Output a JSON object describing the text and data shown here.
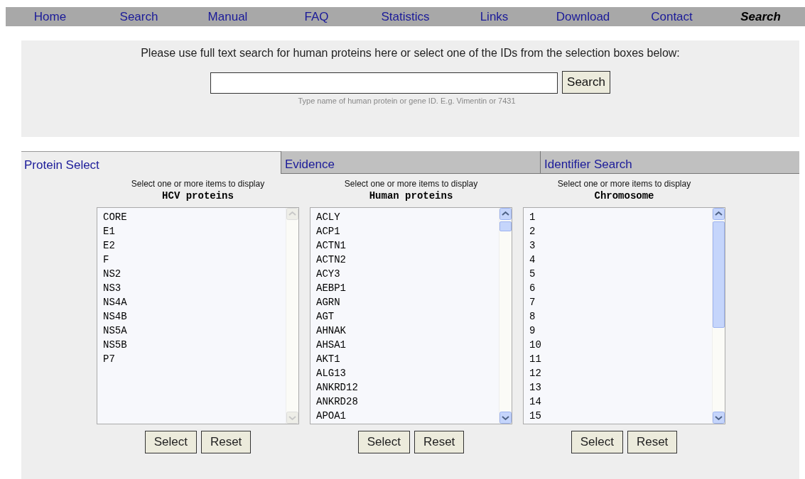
{
  "nav": [
    {
      "label": "Home",
      "selected": false
    },
    {
      "label": "Search",
      "selected": false
    },
    {
      "label": "Manual",
      "selected": false
    },
    {
      "label": "FAQ",
      "selected": false
    },
    {
      "label": "Statistics",
      "selected": false
    },
    {
      "label": "Links",
      "selected": false
    },
    {
      "label": "Download",
      "selected": false
    },
    {
      "label": "Contact",
      "selected": false
    },
    {
      "label": "Search",
      "selected": true
    }
  ],
  "search": {
    "intro": "Please use full text search for human proteins here or select one of the IDs from the selection boxes below:",
    "button": "Search",
    "hint": "Type name of human protein or gene ID. E.g. Vimentin or 7431"
  },
  "tabs": [
    {
      "label": "Protein Select",
      "selected": true
    },
    {
      "label": "Evidence",
      "selected": false
    },
    {
      "label": "Identifier Search",
      "selected": false
    }
  ],
  "lists": [
    {
      "caption": "Select one or more items to display",
      "title": "HCV proteins",
      "items": [
        "CORE",
        "E1",
        "E2",
        "F",
        "NS2",
        "NS3",
        "NS4A",
        "NS4B",
        "NS5A",
        "NS5B",
        "P7"
      ],
      "buttons": [
        "Select",
        "Reset"
      ]
    },
    {
      "caption": "Select one or more items to display",
      "title": "Human proteins",
      "items": [
        "ACLY",
        "ACP1",
        "ACTN1",
        "ACTN2",
        "ACY3",
        "AEBP1",
        "AGRN",
        "AGT",
        "AHNAK",
        "AHSA1",
        "AKT1",
        "ALG13",
        "ANKRD12",
        "ANKRD28",
        "APOA1"
      ],
      "buttons": [
        "Select",
        "Reset"
      ]
    },
    {
      "caption": "Select one or more items to display",
      "title": "Chromosome",
      "items": [
        "1",
        "2",
        "3",
        "4",
        "5",
        "6",
        "7",
        "8",
        "9",
        "10",
        "11",
        "12",
        "13",
        "14",
        "15"
      ],
      "buttons": [
        "Select",
        "Reset"
      ]
    }
  ]
}
